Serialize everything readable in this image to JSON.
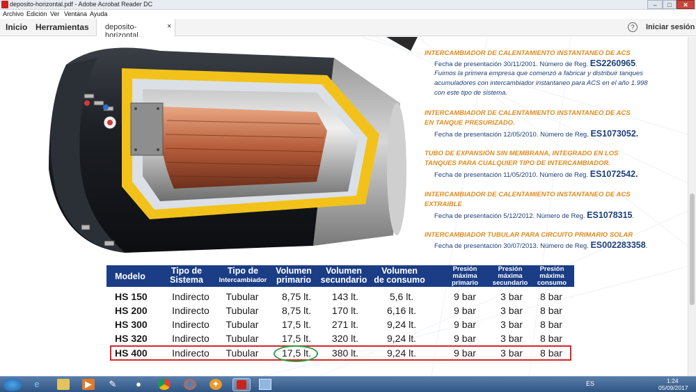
{
  "window": {
    "title": "deposito-horizontal.pdf - Adobe Acrobat Reader DC",
    "minimize": "–",
    "maximize": "□",
    "close": "✕"
  },
  "menu": [
    "Archivo",
    "Edición",
    "Ver",
    "Ventana",
    "Ayuda"
  ],
  "toolbar": {
    "home": "Inicio",
    "tools": "Herramientas",
    "doc_tab": "deposito-horizontal...",
    "doc_tab_close": "×",
    "help": "?",
    "signin": "Iniciar sesión"
  },
  "patents": [
    {
      "heading": [
        "INTERCAMBIADOR DE CALENTAMIENTO INSTANTANEO DE ACS"
      ],
      "date_text": "Fecha de presentación 30/11/2001. Número de Reg.",
      "reg": "ES2260965",
      "reg_suffix": ".",
      "note": [
        "Fuimos la primera empresa que comenzó a fabricar y distribuir tanques",
        "acumuladores con intercambiador instantaneo para ACS en el año 1.998",
        "con este tipo de sistema."
      ]
    },
    {
      "heading": [
        "INTERCAMBIADOR DE CALENTAMIENTO INSTANTANEO DE ACS",
        "EN TANQUE PRESURIZADO."
      ],
      "date_text": "Fecha de presentación 12/05/2010. Número de Reg.",
      "reg": "ES1073052.",
      "reg_suffix": ""
    },
    {
      "heading": [
        "TUBO DE EXPANSIÓN SIN MEMBRANA, INTEGRADO EN LOS",
        "TANQUES PARA CUALQUIER TIPO DE INTERCAMBIADOR."
      ],
      "date_text": "Fecha de presentación 11/05/2010. Número de Reg.",
      "reg": "ES1072542.",
      "reg_suffix": ""
    },
    {
      "heading": [
        "INTERCAMBIADOR DE CALENTAMIENTO INSTANTANEO DE ACS",
        "EXTRAIBLE"
      ],
      "date_text": "Fecha de presentación 5/12/2012. Número de Reg.",
      "reg": "ES1078315",
      "reg_suffix": "."
    },
    {
      "heading": [
        "INTERCAMBIADOR TUBULAR PARA CIRCUITO PRIMARIO SOLAR"
      ],
      "date_text": "Fecha de presentación 30/07/2013. Número de Reg.",
      "reg": "ES002283358",
      "reg_suffix": "."
    }
  ],
  "table": {
    "headers": [
      {
        "lines": [
          "Modelo"
        ]
      },
      {
        "lines": [
          "Tipo de",
          "Sistema"
        ]
      },
      {
        "lines": [
          "Tipo de",
          "Intercambiador"
        ]
      },
      {
        "lines": [
          "Volumen",
          "primario"
        ]
      },
      {
        "lines": [
          "Volumen",
          "secundario"
        ]
      },
      {
        "lines": [
          "Volumen",
          "de consumo"
        ]
      },
      {
        "lines": [
          "Presión",
          "máxima",
          "primario"
        ]
      },
      {
        "lines": [
          "Presión",
          "máxima",
          "secundario"
        ]
      },
      {
        "lines": [
          "Presión",
          "máxima",
          "consumo"
        ]
      }
    ],
    "rows": [
      [
        "HS 150",
        "Indirecto",
        "Tubular",
        "8,75 lt.",
        "143 lt.",
        "5,6 lt.",
        "9 bar",
        "3 bar",
        "8 bar"
      ],
      [
        "HS 200",
        "Indirecto",
        "Tubular",
        "8,75 lt.",
        "170 lt.",
        "6,16 lt.",
        "9 bar",
        "3 bar",
        "8 bar"
      ],
      [
        "HS 300",
        "Indirecto",
        "Tubular",
        "17,5 lt.",
        "271 lt.",
        "9,24 lt.",
        "9 bar",
        "3 bar",
        "8 bar"
      ],
      [
        "HS 320",
        "Indirecto",
        "Tubular",
        "17,5 lt.",
        "320 lt.",
        "9,24 lt.",
        "9 bar",
        "3 bar",
        "8 bar"
      ],
      [
        "HS 400",
        "Indirecto",
        "Tubular",
        "17,5 lt.",
        "380 lt.",
        "9,24 lt.",
        "9 bar",
        "3 bar",
        "8 bar"
      ]
    ],
    "highlight_row": "HS 400",
    "highlight_color": "#d8242a",
    "circle_color": "#2ea043"
  },
  "taskbar": {
    "apps": [
      "windows-start",
      "internet-explorer",
      "file-explorer",
      "media-player",
      "app-tool",
      "app-paint",
      "chrome",
      "firefox",
      "app-settings",
      "acrobat-reader",
      "app-window"
    ],
    "lang": "ES",
    "time": "1:24",
    "date": "05/09/2017"
  },
  "colors": {
    "accent_orange": "#e08a1c",
    "navy": "#1d3f7a",
    "table_header": "#1b3d86"
  }
}
